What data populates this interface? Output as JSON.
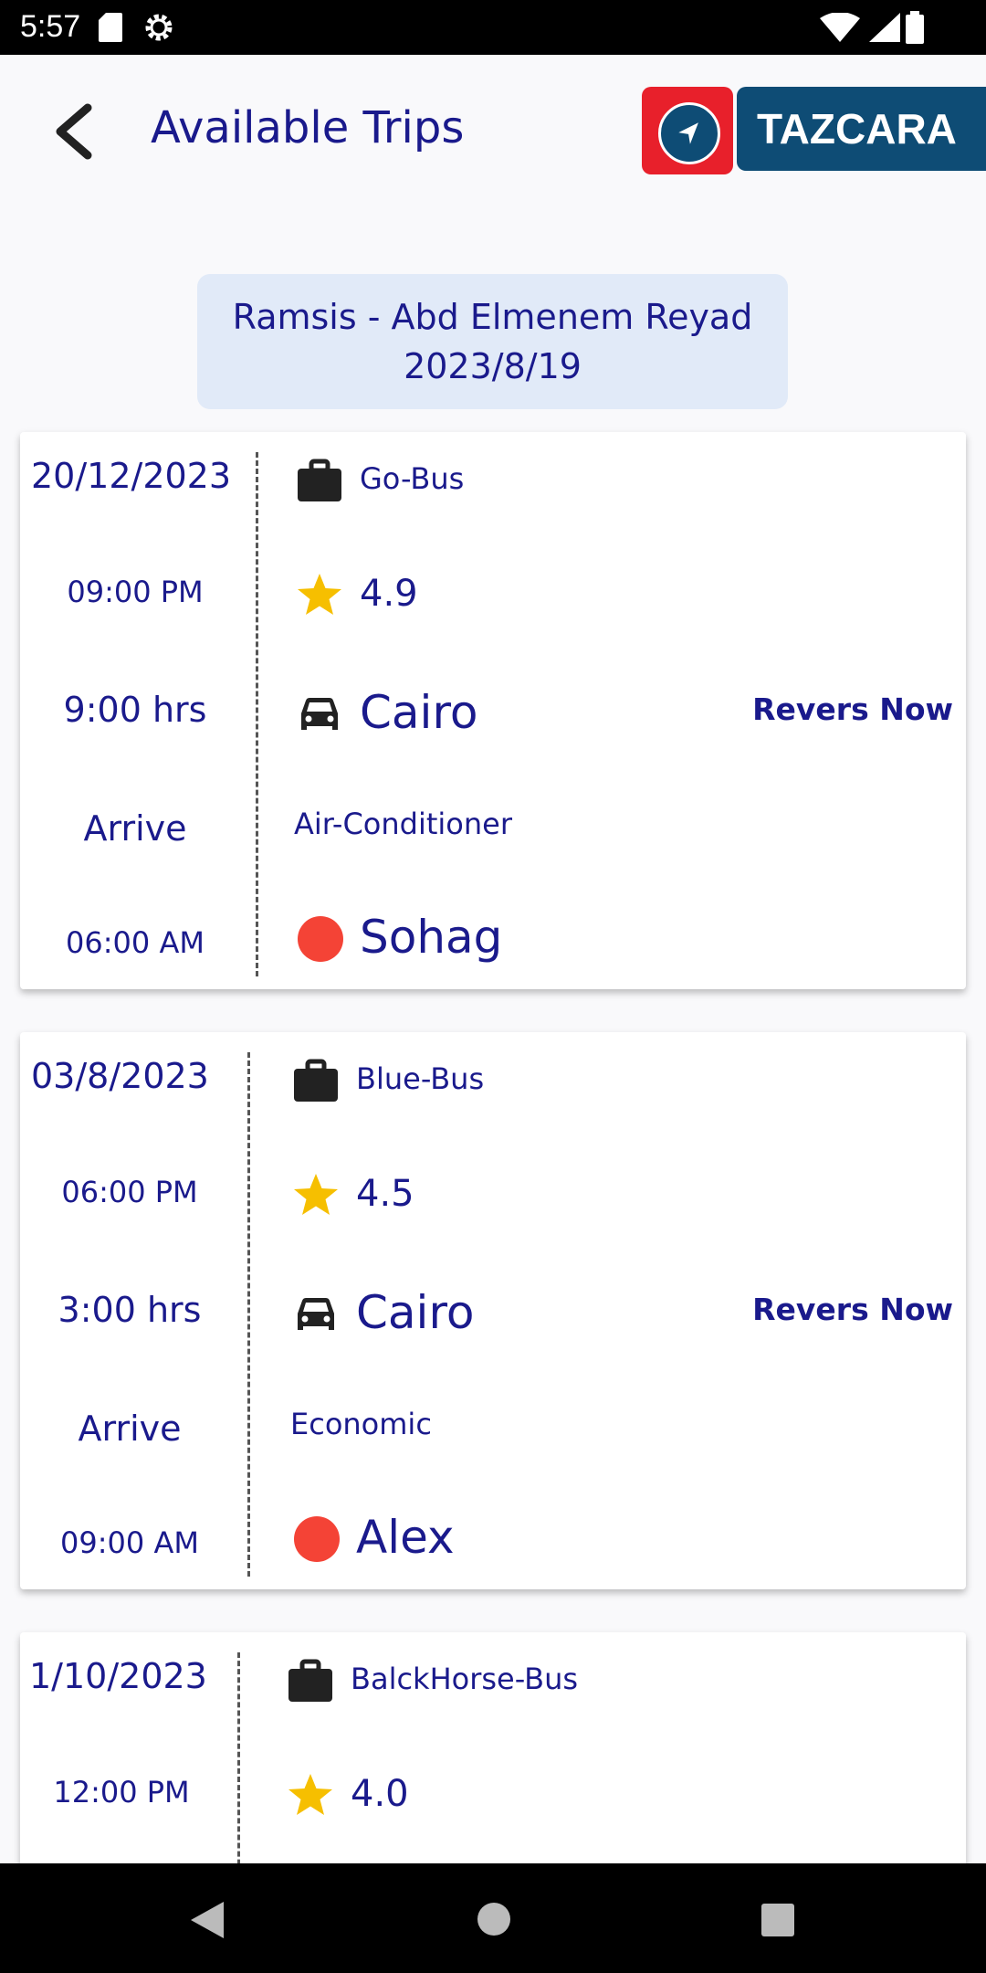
{
  "status_bar": {
    "time": "5:57"
  },
  "header": {
    "title": "Available Trips",
    "logo_text": "TAZCARA"
  },
  "route": {
    "line1": "Ramsis - Abd Elmenem Reyad",
    "line2": "2023/8/19"
  },
  "trips": [
    {
      "date": "20/12/2023",
      "departure_time": "09:00 PM",
      "duration": "9:00 hrs",
      "arrive_label": "Arrive",
      "arrival_time": "06:00 AM",
      "company": "Go-Bus",
      "rating": "4.9",
      "from": "Cairo",
      "feature": "Air-Conditioner",
      "to": "Sohag",
      "action": "Revers Now"
    },
    {
      "date": "03/8/2023",
      "departure_time": "06:00 PM",
      "duration": "3:00 hrs",
      "arrive_label": "Arrive",
      "arrival_time": "09:00 AM",
      "company": "Blue-Bus",
      "rating": "4.5",
      "from": "Cairo",
      "feature": "Economic",
      "to": "Alex",
      "action": "Revers Now"
    },
    {
      "date": "1/10/2023",
      "departure_time": "12:00 PM",
      "company": "BalckHorse-Bus",
      "rating": "4.0"
    }
  ],
  "colors": {
    "primary_text": "#1a1a8c",
    "star": "#f6bf00",
    "destination_dot": "#f44336",
    "route_box": "#e1eaf8",
    "logo_red": "#e8202b",
    "logo_blue": "#0e4c75"
  },
  "icons": {
    "back": "arrow-left-icon",
    "company": "briefcase-icon",
    "rating": "star-icon",
    "from": "car-icon",
    "to": "red-dot-icon"
  }
}
